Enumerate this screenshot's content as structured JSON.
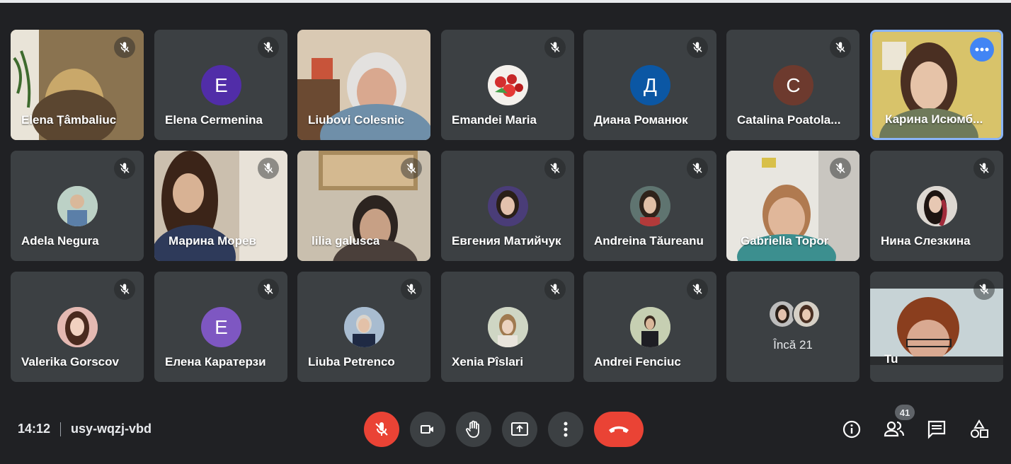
{
  "participants": [
    {
      "name": "Elena Țâmbaliuc"
    },
    {
      "name": "Elena Cermenina",
      "initial": "E",
      "color": "#512da8"
    },
    {
      "name": "Liubovi Colesnic"
    },
    {
      "name": "Emandei Maria"
    },
    {
      "name": "Диана Романюк",
      "initial": "Д",
      "color": "#0b57a4"
    },
    {
      "name": "Catalina Poatola..."
    },
    {
      "name": "Карина Исюмб...",
      "initial": "C",
      "color": "#6d3a2e"
    },
    {
      "name": "Adela Negura"
    },
    {
      "name": "Марина Морев"
    },
    {
      "name": "lilia galusca"
    },
    {
      "name": "Евгения Матийчук"
    },
    {
      "name": "Andreina Tăureanu"
    },
    {
      "name": "Gabriella Topor"
    },
    {
      "name": "Нина Слезкина"
    },
    {
      "name": "Valerika Gorscov"
    },
    {
      "name": "Елена Каратерзи",
      "initial": "E",
      "color": "#7e57c2"
    },
    {
      "name": "Liuba Petrenco"
    },
    {
      "name": "Xenia Pîslari"
    },
    {
      "name": "Andrei Fenciuc"
    },
    {
      "name": "Tu"
    }
  ],
  "more_tile": {
    "label": "Încă 21"
  },
  "bottom_bar": {
    "time": "14:12",
    "meeting_code": "usy-wqzj-vbd",
    "participants_count": "41"
  },
  "icons": {
    "muted": "mic-off-icon",
    "more": "more-options-icon",
    "mic": "mic-off-icon",
    "camera": "camera-icon",
    "hand": "raise-hand-icon",
    "present": "present-screen-icon",
    "options": "more-vert-icon",
    "end": "end-call-icon",
    "info": "info-icon",
    "people": "people-icon",
    "chat": "chat-icon",
    "activities": "activities-icon"
  },
  "colors": {
    "background": "#202124",
    "tile": "#3c4043",
    "accent": "#8ab4f8",
    "red": "#ea4335",
    "blue": "#4285f4"
  }
}
